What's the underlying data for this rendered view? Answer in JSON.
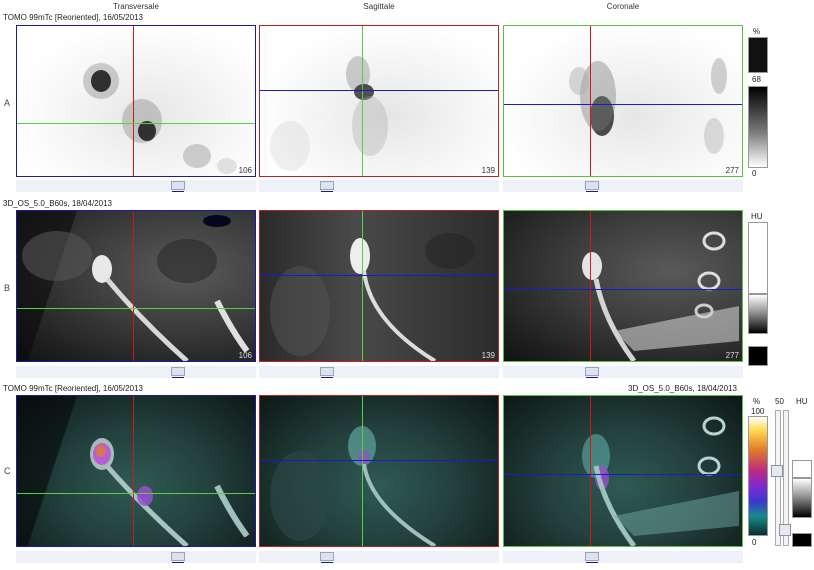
{
  "columns": {
    "transversale": "Transversale",
    "sagittale": "Sagittale",
    "coronale": "Coronale"
  },
  "rows": {
    "a": {
      "label": "A",
      "title": "TOMO 99mTc [Reoriented], 16/05/2013"
    },
    "b": {
      "label": "B",
      "title": "3D_OS_5.0_B60s, 18/04/2013"
    },
    "c": {
      "label": "C",
      "title_left": "TOMO 99mTc [Reoriented], 16/05/2013",
      "title_right": "3D_OS_5.0_B60s, 18/04/2013"
    }
  },
  "slices": {
    "transversale": "106",
    "sagittale": "139",
    "coronale": "277"
  },
  "scale_a": {
    "unit": "%",
    "level": "68",
    "min": "0"
  },
  "scale_b": {
    "unit": "HU"
  },
  "scale_c": {
    "unit": "%",
    "max": "100",
    "min": "0",
    "level": "50",
    "unit2": "HU"
  },
  "colors": {
    "transversale_frame": "#1a1aa8",
    "sagittale_frame": "#c02020",
    "coronale_frame": "#58c040"
  }
}
